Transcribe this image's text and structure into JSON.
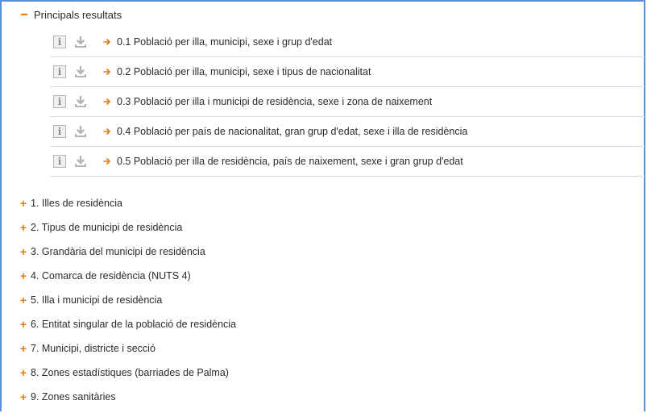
{
  "section": {
    "toggle_symbol": "−",
    "title": "Principals resultats"
  },
  "colors": {
    "accent": "#e8760f",
    "frame": "#5b8fd0"
  },
  "tables": [
    {
      "label": "0.1 Població per illa, municipi, sexe i grup d'edat"
    },
    {
      "label": "0.2 Població per illa, municipi, sexe i tipus de nacionalitat"
    },
    {
      "label": "0.3 Població per illa i municipi de residència, sexe i zona de naixement"
    },
    {
      "label": "0.4 Població per país de nacionalitat, gran grup d'edat, sexe i illa de residència"
    },
    {
      "label": "0.5 Població per illa de residència, país de naixement, sexe i gran grup d'edat"
    }
  ],
  "icons": {
    "info": "info-icon",
    "download": "download-icon",
    "arrow": "arrow-right-icon",
    "expand": "plus-icon",
    "collapse": "minus-icon"
  },
  "info_glyph": "i",
  "categories": [
    {
      "label": "1. Illes de residència"
    },
    {
      "label": "2. Tipus de municipi de residència"
    },
    {
      "label": "3. Grandària del municipi de residència"
    },
    {
      "label": "4. Comarca de residència (NUTS 4)"
    },
    {
      "label": "5. Illa i municipi de residència"
    },
    {
      "label": "6. Entitat singular de la població de residència"
    },
    {
      "label": "7. Municipi, districte i secció"
    },
    {
      "label": "8. Zones estadístiques (barriades de Palma)"
    },
    {
      "label": "9. Zones sanitàries"
    }
  ]
}
